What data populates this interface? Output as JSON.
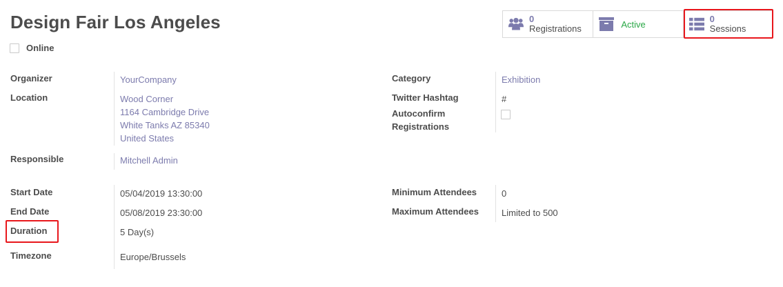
{
  "event": {
    "title": "Design Fair Los Angeles",
    "online_label": "Online"
  },
  "stat_buttons": {
    "registrations": {
      "value": "0",
      "label": "Registrations",
      "icon": "users-icon"
    },
    "active": {
      "label": "Active",
      "icon": "archive-box-icon"
    },
    "sessions": {
      "value": "0",
      "label": "Sessions",
      "icon": "list-icon"
    }
  },
  "left_fields": {
    "organizer": {
      "label": "Organizer",
      "value": "YourCompany"
    },
    "location": {
      "label": "Location",
      "lines": [
        "Wood Corner",
        "1164 Cambridge Drive",
        "White Tanks AZ 85340",
        "United States"
      ]
    },
    "responsible": {
      "label": "Responsible",
      "value": "Mitchell Admin"
    },
    "start_date": {
      "label": "Start Date",
      "value": "05/04/2019 13:30:00"
    },
    "end_date": {
      "label": "End Date",
      "value": "05/08/2019 23:30:00"
    },
    "duration": {
      "label": "Duration",
      "value": "5 Day(s)"
    },
    "timezone": {
      "label": "Timezone",
      "value": "Europe/Brussels"
    }
  },
  "right_fields": {
    "category": {
      "label": "Category",
      "value": "Exhibition"
    },
    "twitter_hashtag": {
      "label": "Twitter Hashtag",
      "value": "#"
    },
    "autoconfirm": {
      "label_line1": "Autoconfirm",
      "label_line2": "Registrations",
      "checked": false
    },
    "min_attendees": {
      "label": "Minimum Attendees",
      "value": "0"
    },
    "max_attendees": {
      "label": "Maximum Attendees",
      "value": "Limited to 500"
    }
  },
  "colors": {
    "link": "#7c7bad",
    "active_green": "#28a745",
    "highlight_red": "#e8161b",
    "text": "#4c4c4c"
  }
}
